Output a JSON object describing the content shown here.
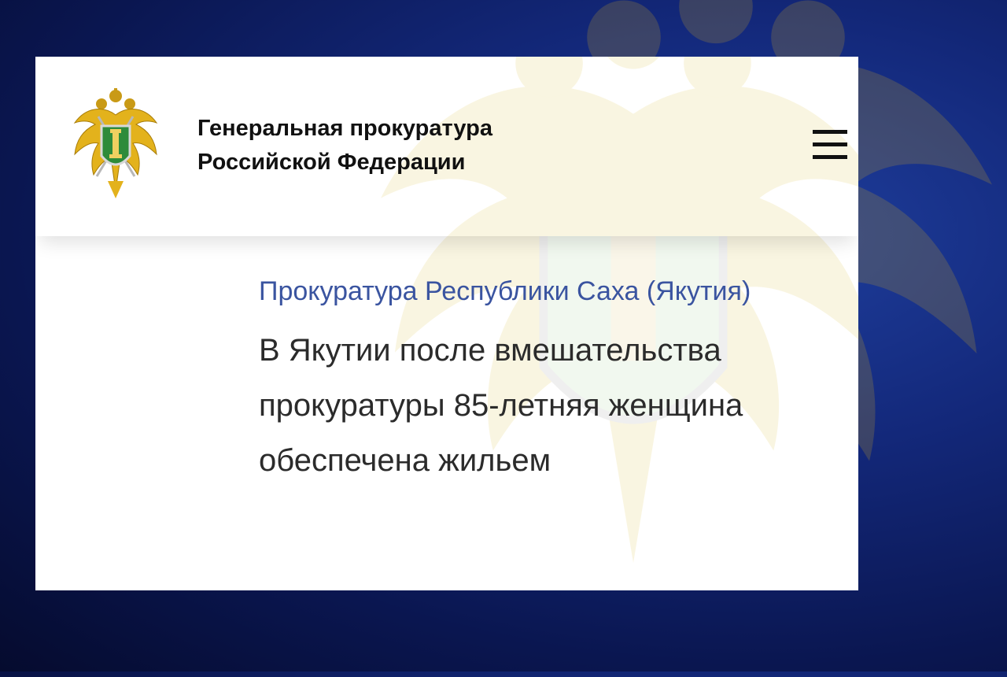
{
  "header": {
    "org_name_line1": "Генеральная прокуратура",
    "org_name_line2": "Российской Федерации",
    "logo_icon": "prosecutor-emblem-icon",
    "menu_icon": "hamburger-menu-icon"
  },
  "article": {
    "region": "Прокуратура Республики Саха (Якутия)",
    "headline_line1": "В Якутии после вмешательства",
    "headline_line2": "прокуратуры 85-летняя женщина",
    "headline_line3": "обеспечена жильем"
  },
  "colors": {
    "background": "#13287a",
    "region_link": "#3a54a0",
    "headline_text": "#2b2b2b",
    "emblem_gold": "#e0b020",
    "emblem_green": "#2e8b3a"
  }
}
